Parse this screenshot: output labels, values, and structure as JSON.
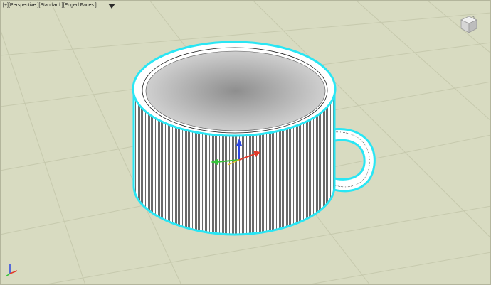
{
  "viewport": {
    "label_parts": [
      "[+]",
      " [Perspective ]",
      " [Standard ]",
      " [Edged Faces ]"
    ],
    "filter_icon": "filter-icon",
    "viewcube_icon": "viewcube-home-icon"
  },
  "colors": {
    "background": "#d8dbc1",
    "grid": "#c7caaf",
    "grid_major": "#b6b99e",
    "mesh_fill": "#ffffff",
    "mesh_wire": "#1a1a1a",
    "selection": "#29e6f4",
    "axis_x": "#e23a2a",
    "axis_y": "#36c23a",
    "axis_z": "#2b45e0"
  }
}
